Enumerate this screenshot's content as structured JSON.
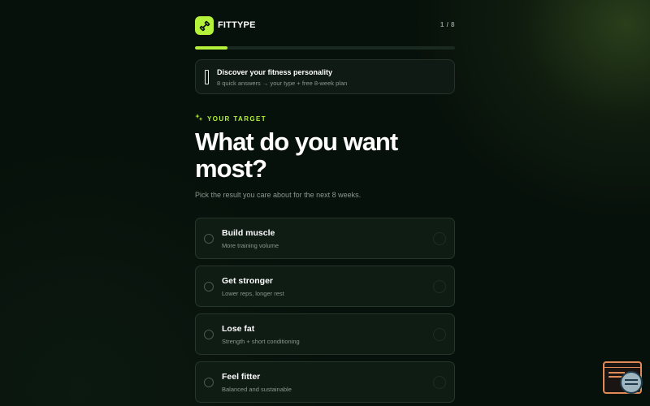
{
  "brand": {
    "name": "FITTYPE",
    "logo_icon": "dumbbell-icon",
    "accent": "#b5f23a"
  },
  "progress": {
    "counter": "1 / 8",
    "fraction": 0.125
  },
  "banner": {
    "icon": "phone-icon",
    "title": "Discover your fitness personality",
    "subtitle": "8 quick answers → your type + free 8-week plan"
  },
  "question": {
    "eyebrow": "YOUR TARGET",
    "eyebrow_icon": "sparkle-icon",
    "title": "What do you want most?",
    "subtitle": "Pick the result you care about for the next 8 weeks."
  },
  "options": [
    {
      "label": "Build muscle",
      "desc": "More training volume"
    },
    {
      "label": "Get stronger",
      "desc": "Lower reps, longer rest"
    },
    {
      "label": "Lose fat",
      "desc": "Strength + short conditioning"
    },
    {
      "label": "Feel fitter",
      "desc": "Balanced and sustainable"
    }
  ],
  "widget": {
    "icon": "code-window-icon"
  }
}
